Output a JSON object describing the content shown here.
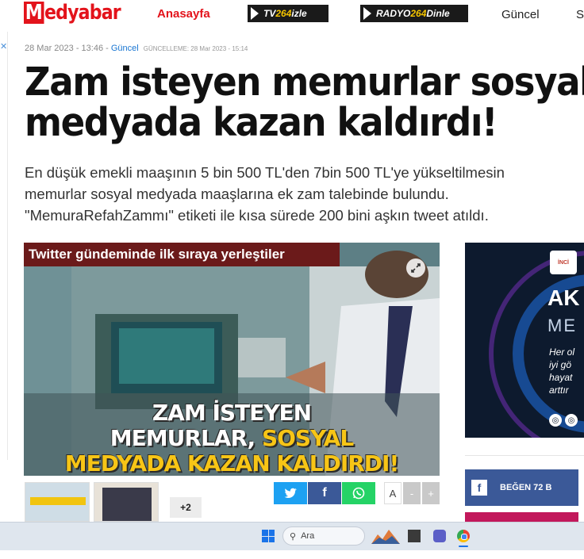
{
  "nav": {
    "logo_m": "M",
    "logo_rest": "edyabar",
    "home": "Anasayfa",
    "tv_prefix": "TV",
    "tv_hl": "264",
    "tv_suffix": " izle",
    "radio_prefix": "RADYO",
    "radio_hl": "264",
    "radio_suffix": " Dinle",
    "guncel": "Güncel",
    "cut_item": "S"
  },
  "article": {
    "date": "28 Mar 2023 - 13:46",
    "sep": " - ",
    "category": "Güncel",
    "updated": "GÜNCELLEME: 28 Mar 2023 - 15:14",
    "title_line1": "Zam isteyen memurlar sosyal",
    "title_line2": "medyada kazan kaldırdı!",
    "summary_line1": "En düşük emekli maaşının 5 bin 500 TL'den 7bin 500 TL'ye yükseltilmesin",
    "summary_line2": "memurlar sosyal medyada maaşlarına ek zam talebinde bulundu.",
    "summary_line3": "\"MemuraRefahZammı\" etiketi ile kısa sürede 200 bini aşkın tweet atıldı."
  },
  "hero": {
    "strip": "Twitter gündeminde ilk sıraya yerleştiler",
    "cap1": "ZAM İSTEYEN",
    "cap2a": "MEMURLAR, ",
    "cap2b": "SOSYAL",
    "cap3": "MEDYADA KAZAN KALDIRDI!",
    "more_count": "+2"
  },
  "share": {
    "font_a": "A",
    "font_minus": "-",
    "font_plus": "+"
  },
  "ad": {
    "logo": "İNCİ",
    "t1": "AK",
    "t2": "ME",
    "body": "Her ol\niyi gö\nhayat\narttır"
  },
  "sidebar": {
    "like_label": "BEĞEN 72 B"
  },
  "taskbar": {
    "search_placeholder": "Ara"
  }
}
